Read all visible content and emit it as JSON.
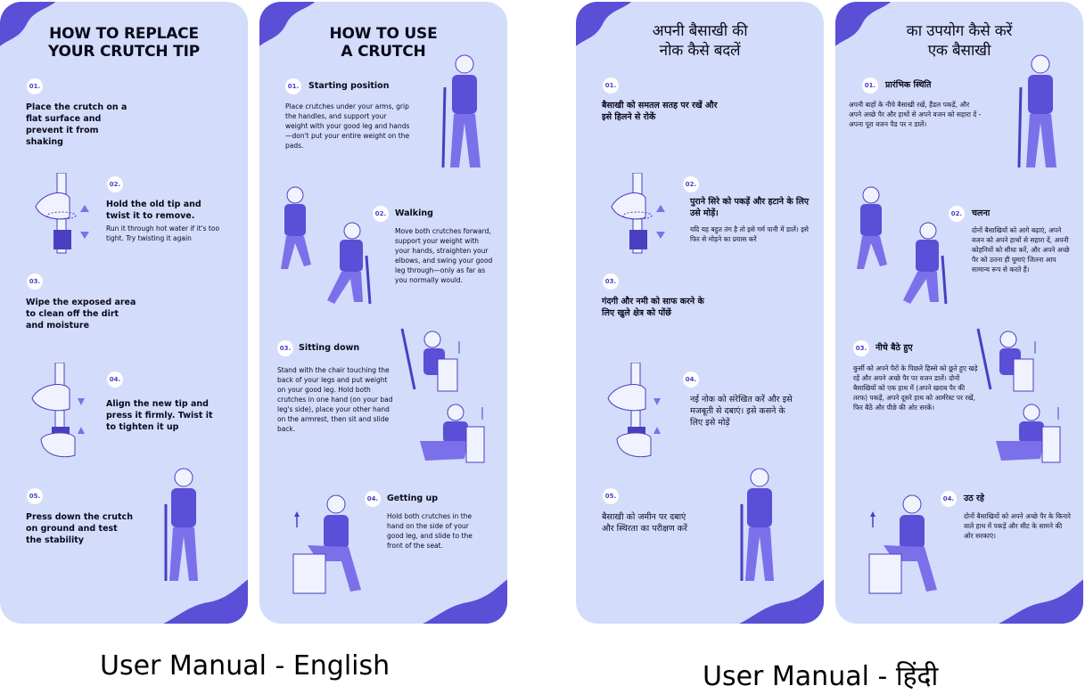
{
  "captions": {
    "english": "User Manual - English",
    "hindi": "User Manual - हिंदी"
  },
  "colors": {
    "panel": "#d3dcfb",
    "accent": "#4a3fc1",
    "figure": "#5a4fd6"
  },
  "en_tip": {
    "title_1": "HOW TO REPLACE",
    "title_2": "YOUR CRUTCH TIP",
    "steps": [
      {
        "num": "01.",
        "text": "Place the crutch on a flat surface and prevent it from shaking"
      },
      {
        "num": "02.",
        "head": "Hold the old tip and twist it to remove.",
        "body": "Run it through hot water if it's too tight. Try twisting it again"
      },
      {
        "num": "03.",
        "text": "Wipe the exposed area to clean off the dirt and moisture"
      },
      {
        "num": "04.",
        "text": "Align the new tip and press it firmly. Twist it to tighten it up"
      },
      {
        "num": "05.",
        "text": "Press down the crutch on ground and test the stability"
      }
    ]
  },
  "en_use": {
    "title_1": "HOW TO USE",
    "title_2": "A CRUTCH",
    "steps": [
      {
        "num": "01.",
        "head": "Starting position",
        "body": "Place crutches under your arms, grip the handles, and support your weight with your good leg and hands—don't put your entire weight on the pads."
      },
      {
        "num": "02.",
        "head": "Walking",
        "body": "Move both crutches forward, support your weight with your hands, straighten your elbows, and swing your good leg through—only as far as you normally would."
      },
      {
        "num": "03.",
        "head": "Sitting down",
        "body": "Stand with the chair touching the back of your legs and put weight on your good leg. Hold both crutches in one hand (on your bad leg's side), place your other hand on the armrest, then sit and slide back."
      },
      {
        "num": "04.",
        "head": "Getting up",
        "body": "Hold both crutches in the hand on the side of your good leg, and slide to the front of the seat."
      }
    ]
  },
  "hi_tip": {
    "title_1": "अपनी बैसाखी की",
    "title_2": "नोक कैसे बदलें",
    "steps": [
      {
        "num": "01.",
        "text": "बैसाखी को समतल सतह पर रखें और इसे हिलने से रोकें"
      },
      {
        "num": "02.",
        "head": "पुराने सिरे को पकड़ें और हटाने के लिए उसे मोड़ें।",
        "body": "यदि यह बहुत तंग है तो इसे गर्म पानी में डालें। इसे फिर से मोड़ने का प्रयास करें"
      },
      {
        "num": "03.",
        "text": "गंदगी और नमी को साफ करने के लिए खुले क्षेत्र को पोंछें"
      },
      {
        "num": "04.",
        "text": "नई नोक को संरेखित करें और इसे मजबूती से दबाएं। इसे कसने के लिए इसे मोड़ें"
      },
      {
        "num": "05.",
        "text": "बैसाखी को जमीन पर दबाएं और स्थिरता का परीक्षण करें"
      }
    ]
  },
  "hi_use": {
    "title_1": "का उपयोग कैसे करें",
    "title_2": "एक बैसाखी",
    "steps": [
      {
        "num": "01.",
        "head": "प्रारंभिक स्थिति",
        "body": "अपनी बाहों के नीचे बैसाखी रखें, हैंडल पकड़ें, और अपने अच्छे पैर और हाथों से अपने वजन को सहारा दें - अपना पूरा वजन पैड पर न डालें।"
      },
      {
        "num": "02.",
        "head": "चलना",
        "body": "दोनों बैसाखियों को आगे बढ़ाएं, अपने वजन को अपने हाथों से सहारा दें, अपनी कोहनियों को सीधा करें, और अपने अच्छे पैर को उतना ही घुमाएं जितना आप सामान्य रूप से करते हैं।"
      },
      {
        "num": "03.",
        "head": "नीचे बैठे हुए",
        "body": "कुर्सी को अपने पैरों के पिछले हिस्से को छूते हुए खड़े रहें और अपने अच्छे पैर पर वजन डालें। दोनों बैसाखियों को एक हाथ में (अपने खराब पैर की तरफ) पकड़ें, अपने दूसरे हाथ को आर्मरेस्ट पर रखें, फिर बैठें और पीछे की ओर सरकें।"
      },
      {
        "num": "04.",
        "head": "उठ रहे",
        "body": "दोनों बैसाखियों को अपने अच्छे पैर के किनारे वाले हाथ में पकड़ें और सीट के सामने की ओर सरकाएं।"
      }
    ]
  }
}
